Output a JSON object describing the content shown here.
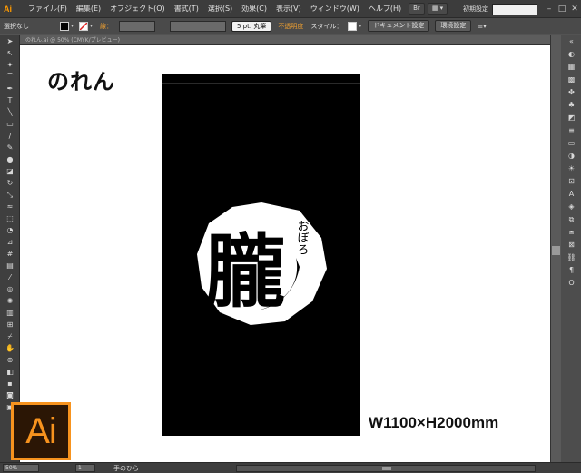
{
  "app": {
    "logo_text": "Ai",
    "menu": [
      "ファイル(F)",
      "編集(E)",
      "オブジェクト(O)",
      "書式(T)",
      "選択(S)",
      "効果(C)",
      "表示(V)",
      "ウィンドウ(W)",
      "ヘルプ(H)"
    ],
    "workspace": "初期設定",
    "window_controls": [
      "–",
      "□",
      "✕"
    ]
  },
  "controlbar": {
    "selection_status": "選択なし",
    "stroke_label": "線：",
    "brush_label": "5 pt. 丸筆",
    "opacity_label": "不透明度",
    "style_label": "スタイル：",
    "document_settings": "ドキュメント設定",
    "preferences": "環境設定"
  },
  "document": {
    "tab_title": "のれん.ai @ 50% (CMYK/プレビュー)"
  },
  "canvas": {
    "heading": "のれん",
    "dimension": "W1100×H2000mm",
    "artwork": {
      "kanji": "朧",
      "furigana": "おぼろ"
    }
  },
  "status": {
    "zoom": "50%",
    "page": "1",
    "tool": "手のひら"
  },
  "badge": {
    "text": "Ai",
    "color": "#f7931e"
  },
  "tools": [
    "selection-arrow",
    "direct-select",
    "magic-wand",
    "lasso",
    "pen",
    "type",
    "line",
    "rectangle",
    "paintbrush",
    "pencil",
    "blob-brush",
    "eraser",
    "rotate",
    "scale",
    "warp",
    "free-transform",
    "shape-builder",
    "perspective",
    "mesh",
    "gradient",
    "eyedropper",
    "blend",
    "symbol-sprayer",
    "graph",
    "artboard",
    "slice",
    "hand",
    "zoom"
  ],
  "panels": [
    "color",
    "color-guide",
    "swatches",
    "brushes",
    "symbols",
    "graphic-styles",
    "stroke",
    "gradient",
    "transparency",
    "appearance",
    "layers",
    "artboards",
    "align",
    "pathfinder",
    "transform",
    "links",
    "character",
    "paragraph",
    "opentype"
  ]
}
